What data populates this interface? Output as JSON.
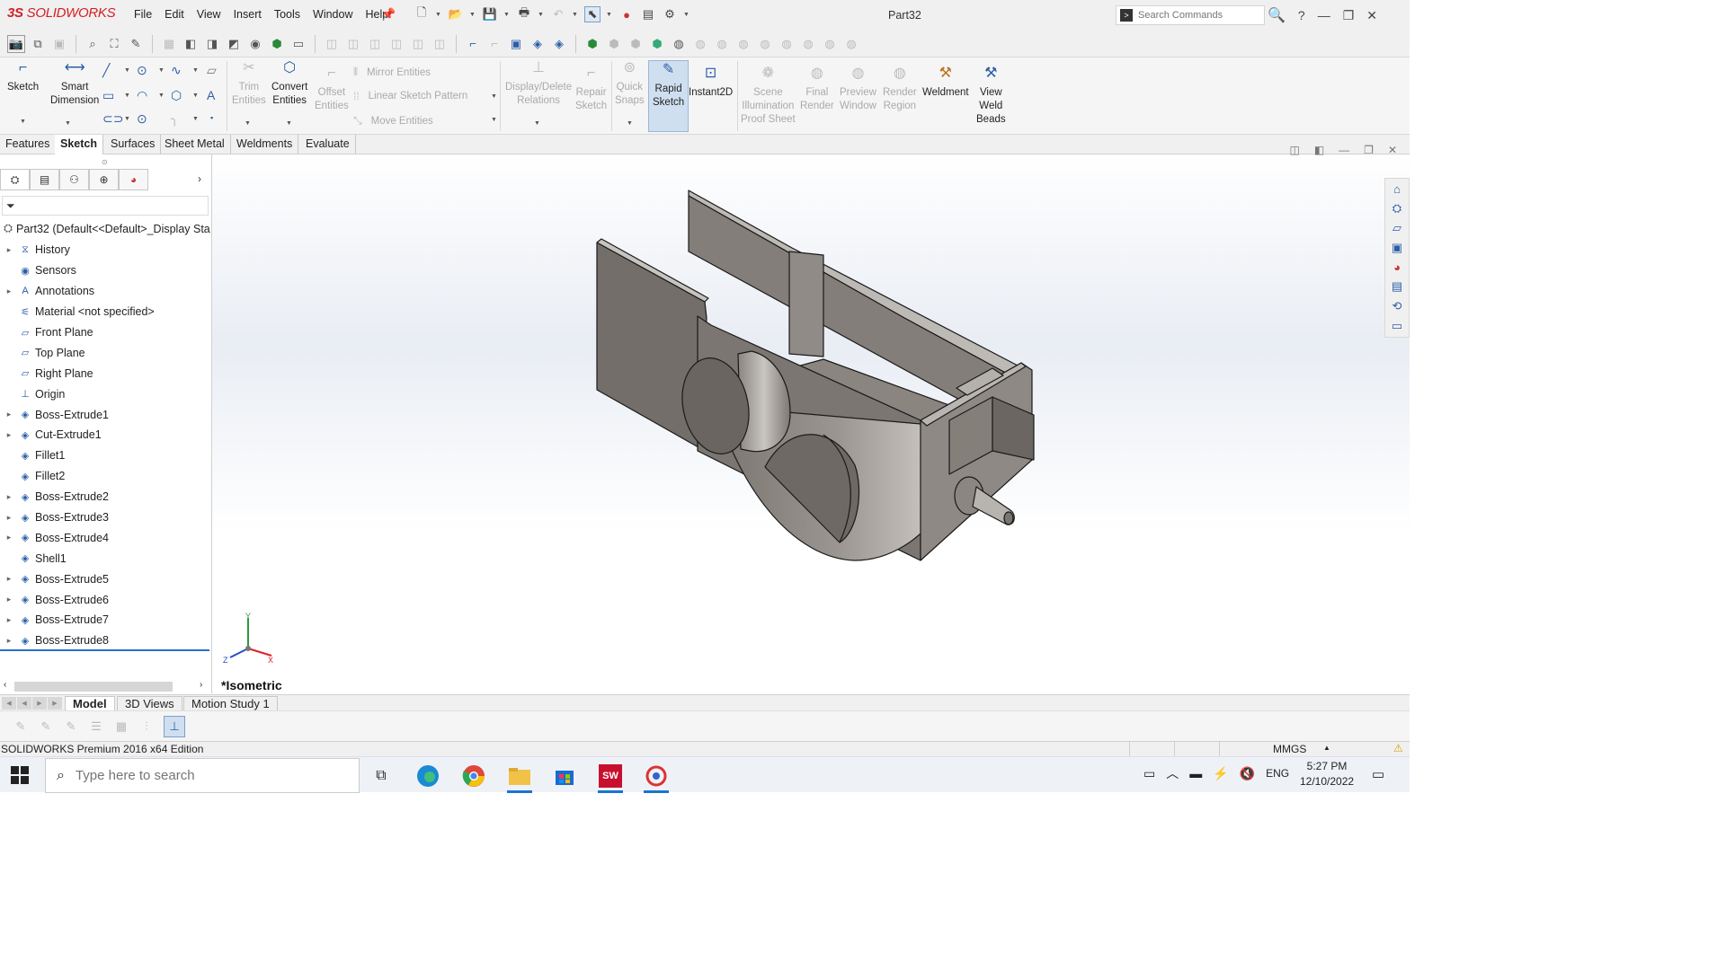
{
  "app": {
    "brand_ds": "3S",
    "brand_name": "SOLIDWORKS",
    "menu": [
      "File",
      "Edit",
      "View",
      "Insert",
      "Tools",
      "Window",
      "Help"
    ],
    "document_title": "Part32",
    "search_placeholder": "Search Commands",
    "help_label": "?"
  },
  "command_manager": {
    "sketch": "Sketch",
    "smart_dimension_1": "Smart",
    "smart_dimension_2": "Dimension",
    "trim_1": "Trim",
    "trim_2": "Entities",
    "convert_1": "Convert",
    "convert_2": "Entities",
    "offset_1": "Offset",
    "offset_2": "Entities",
    "mirror": "Mirror Entities",
    "linear_pattern": "Linear Sketch Pattern",
    "move": "Move Entities",
    "display_delete_1": "Display/Delete",
    "display_delete_2": "Relations",
    "repair_1": "Repair",
    "repair_2": "Sketch",
    "quick_1": "Quick",
    "quick_2": "Snaps",
    "rapid_1": "Rapid",
    "rapid_2": "Sketch",
    "instant2d": "Instant2D",
    "scene_1": "Scene",
    "scene_2": "Illumination",
    "scene_3": "Proof Sheet",
    "final_1": "Final",
    "final_2": "Render",
    "preview_1": "Preview",
    "preview_2": "Window",
    "render_region_1": "Render",
    "render_region_2": "Region",
    "weldment": "Weldment",
    "view_weld_1": "View",
    "view_weld_2": "Weld",
    "view_weld_3": "Beads"
  },
  "tabs": [
    "Features",
    "Sketch",
    "Surfaces",
    "Sheet Metal",
    "Weldments",
    "Evaluate"
  ],
  "active_tab": "Sketch",
  "feature_tree": {
    "root": "Part32  (Default<<Default>_Display Sta",
    "items": [
      {
        "label": "History",
        "expandable": true
      },
      {
        "label": "Sensors",
        "expandable": false
      },
      {
        "label": "Annotations",
        "expandable": true
      },
      {
        "label": "Material <not specified>",
        "expandable": false
      },
      {
        "label": "Front Plane",
        "expandable": false
      },
      {
        "label": "Top Plane",
        "expandable": false
      },
      {
        "label": "Right Plane",
        "expandable": false
      },
      {
        "label": "Origin",
        "expandable": false
      },
      {
        "label": "Boss-Extrude1",
        "expandable": true
      },
      {
        "label": "Cut-Extrude1",
        "expandable": true
      },
      {
        "label": "Fillet1",
        "expandable": false
      },
      {
        "label": "Fillet2",
        "expandable": false
      },
      {
        "label": "Boss-Extrude2",
        "expandable": true
      },
      {
        "label": "Boss-Extrude3",
        "expandable": true
      },
      {
        "label": "Boss-Extrude4",
        "expandable": true
      },
      {
        "label": "Shell1",
        "expandable": false
      },
      {
        "label": "Boss-Extrude5",
        "expandable": true
      },
      {
        "label": "Boss-Extrude6",
        "expandable": true
      },
      {
        "label": "Boss-Extrude7",
        "expandable": true
      },
      {
        "label": "Boss-Extrude8",
        "expandable": true
      }
    ]
  },
  "viewport": {
    "view_name": "*Isometric",
    "triad": {
      "y": "Y",
      "x": "X",
      "z": "Z"
    }
  },
  "bottom_tabs": [
    "Model",
    "3D Views",
    "Motion Study 1"
  ],
  "status": {
    "edition": "SOLIDWORKS Premium 2016 x64 Edition",
    "units": "MMGS"
  },
  "taskbar": {
    "search_placeholder": "Type here to search",
    "lang": "ENG",
    "time": "5:27 PM",
    "date": "12/10/2022",
    "sw_badge": "SW"
  },
  "colors": {
    "brand_red": "#d32027",
    "accent_blue": "#2a6ec6",
    "model_gray": "#8f8a84"
  }
}
